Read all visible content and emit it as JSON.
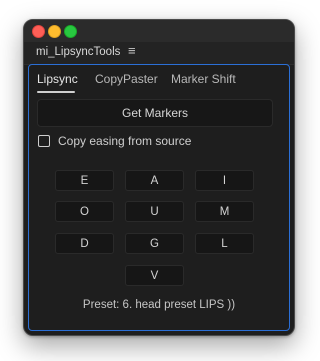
{
  "window": {
    "panel_title": "mi_LipsyncTools",
    "panel_menu_glyph": "≡"
  },
  "tabs": [
    {
      "label": "Lipsync",
      "active": true
    },
    {
      "label": "CopyPaster",
      "active": false
    },
    {
      "label": "Marker Shift",
      "active": false
    }
  ],
  "get_markers_label": "Get Markers",
  "copy_easing": {
    "label": "Copy easing from source",
    "checked": false
  },
  "letters": [
    "E",
    "A",
    "I",
    "O",
    "U",
    "M",
    "D",
    "G",
    "L",
    "V"
  ],
  "preset_text": "Preset: 6. head preset LIPS ))",
  "colors": {
    "panel_bg": "#1e1e1e",
    "focus_border": "#2b6fd6",
    "button_bg": "#161616",
    "text": "#d4d4d4"
  }
}
